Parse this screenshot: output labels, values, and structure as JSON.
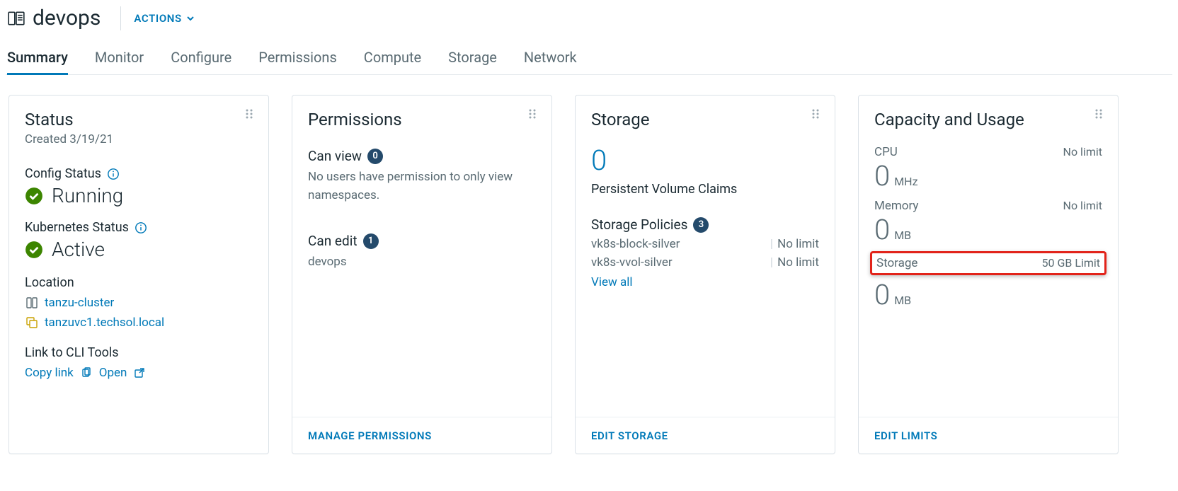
{
  "header": {
    "namespace_name": "devops",
    "actions_label": "ACTIONS"
  },
  "tabs": [
    "Summary",
    "Monitor",
    "Configure",
    "Permissions",
    "Compute",
    "Storage",
    "Network"
  ],
  "active_tab_index": 0,
  "status_card": {
    "title": "Status",
    "created_label": "Created 3/19/21",
    "config_status_label": "Config Status",
    "config_status_value": "Running",
    "k8s_status_label": "Kubernetes Status",
    "k8s_status_value": "Active",
    "location_label": "Location",
    "cluster_link": "tanzu-cluster",
    "vc_link": "tanzuvc1.techsol.local",
    "cli_label": "Link to CLI Tools",
    "copy_link_label": "Copy link",
    "open_label": "Open"
  },
  "permissions_card": {
    "title": "Permissions",
    "can_view_label": "Can view",
    "can_view_count": "0",
    "can_view_desc": "No users have permission to only view namespaces.",
    "can_edit_label": "Can edit",
    "can_edit_count": "1",
    "edit_user": "devops",
    "footer_label": "MANAGE PERMISSIONS"
  },
  "storage_card": {
    "title": "Storage",
    "pvc_count": "0",
    "pvc_label": "Persistent Volume Claims",
    "policies_label": "Storage Policies",
    "policies_count": "3",
    "policies": [
      {
        "name": "vk8s-block-silver",
        "limit": "No limit"
      },
      {
        "name": "vk8s-vvol-silver",
        "limit": "No limit"
      }
    ],
    "view_all": "View all",
    "footer_label": "EDIT STORAGE"
  },
  "capacity_card": {
    "title": "Capacity and Usage",
    "cpu_label": "CPU",
    "cpu_limit": "No limit",
    "cpu_value": "0",
    "cpu_unit": "MHz",
    "mem_label": "Memory",
    "mem_limit": "No limit",
    "mem_value": "0",
    "mem_unit": "MB",
    "storage_label": "Storage",
    "storage_limit": "50 GB Limit",
    "storage_value": "0",
    "storage_unit": "MB",
    "footer_label": "EDIT LIMITS"
  }
}
